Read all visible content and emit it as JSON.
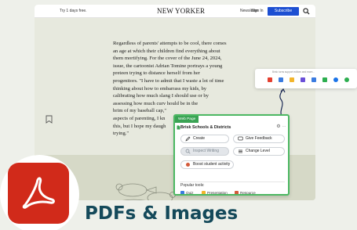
{
  "site": {
    "trial_text": "Try 1 days free.",
    "logo": "NEW YORKER",
    "newsletter": "Newsletter",
    "signin": "Sign In",
    "subscribe": "Subscribe"
  },
  "article": {
    "text": "Regardless of parents' attempts to be cool, there comes\nan age at which their children find everything about\nthem mortifying. For the cover of the June 24, 2024,\nissue, the cartoonist Adrian Tomine portrays a young\npreteen trying to distance herself from her\nprogenitors. \"I have to admit that I waste a lot of time\nthinking about how to embarrass my kids, by\ncalibrating how much slang I should use or by\nassessing how much curv          hould be in the\nbrim of my baseball cap,\"\naspects of parenting, I kn\nthis, but I hope my daugh\ntrying.\""
  },
  "panel": {
    "tag": "Web Page",
    "title": "Brisk Schools & Districts",
    "buttons": [
      {
        "label": "Create"
      },
      {
        "label": "Give Feedback"
      },
      {
        "label": "Inspect Writing"
      },
      {
        "label": "Change Level"
      },
      {
        "label": "Boost student activity"
      }
    ],
    "popular_label": "Popular tools:",
    "chips": [
      {
        "label": "Quiz"
      },
      {
        "label": "Presentation"
      },
      {
        "label": "Resource"
      }
    ]
  },
  "toolbar": {
    "tip": "Brisk turns support editors and more..."
  },
  "caption": "PDFs & Images",
  "colors": {
    "accent_green": "#3aa354",
    "subscribe_blue": "#1d4fd2",
    "adobe_red": "#d12a1a",
    "caption_color": "#14495a"
  },
  "icons": [
    "search-icon",
    "bookmark-icon",
    "brisk-icon",
    "ellipsis-icon",
    "pencil-icon",
    "feedback-icon",
    "magnifier-icon",
    "level-icon",
    "boost-icon",
    "adobe-acrobat-icon"
  ]
}
